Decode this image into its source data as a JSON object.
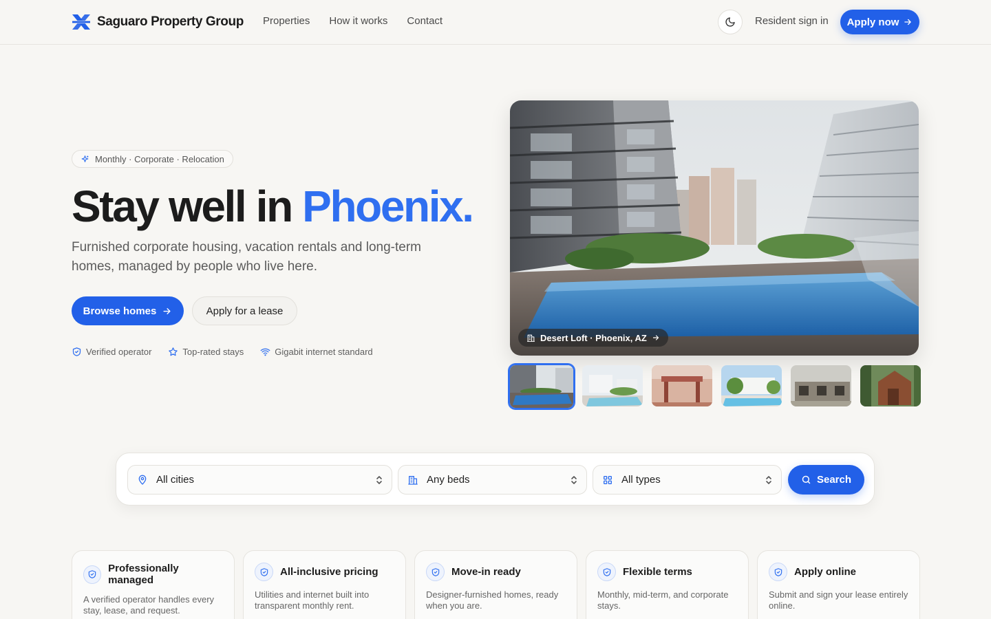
{
  "nav": {
    "brand": "Saguaro Property Group",
    "links": [
      "Properties",
      "How it works",
      "Contact"
    ],
    "signin": "Resident sign in",
    "apply": "Apply now"
  },
  "hero": {
    "eyebrow": "Monthly · Corporate · Relocation",
    "headline_main": "Stay well in ",
    "headline_accent": "Phoenix.",
    "subtitle": "Furnished corporate housing, vacation rentals and long-term homes, managed by people who live here.",
    "cta_primary": "Browse homes",
    "cta_secondary": "Apply for a lease",
    "trust": [
      {
        "label": "Verified operator",
        "icon": "shield-check-icon"
      },
      {
        "label": "Top-rated stays",
        "icon": "star-icon"
      },
      {
        "label": "Gigabit internet standard",
        "icon": "wifi-icon"
      }
    ],
    "photo_tag": "Desert Loft · Phoenix, AZ",
    "selected_thumbnail": 1,
    "thumbnail_count": 6
  },
  "search": {
    "city": "All cities",
    "beds": "Any beds",
    "type": "All types",
    "button": "Search"
  },
  "features": [
    {
      "title": "Professionally managed",
      "desc": "A verified operator handles every stay, lease, and request."
    },
    {
      "title": "All-inclusive pricing",
      "desc": "Utilities and internet built into transparent monthly rent."
    },
    {
      "title": "Move-in ready",
      "desc": "Designer-furnished homes, ready when you are."
    },
    {
      "title": "Flexible terms",
      "desc": "Monthly, mid-term, and corporate stays."
    },
    {
      "title": "Apply online",
      "desc": "Submit and sign your lease entirely online."
    }
  ],
  "colors": {
    "accent": "#2260e8",
    "accent_text": "#2f6ff0",
    "background": "#f7f6f3"
  }
}
